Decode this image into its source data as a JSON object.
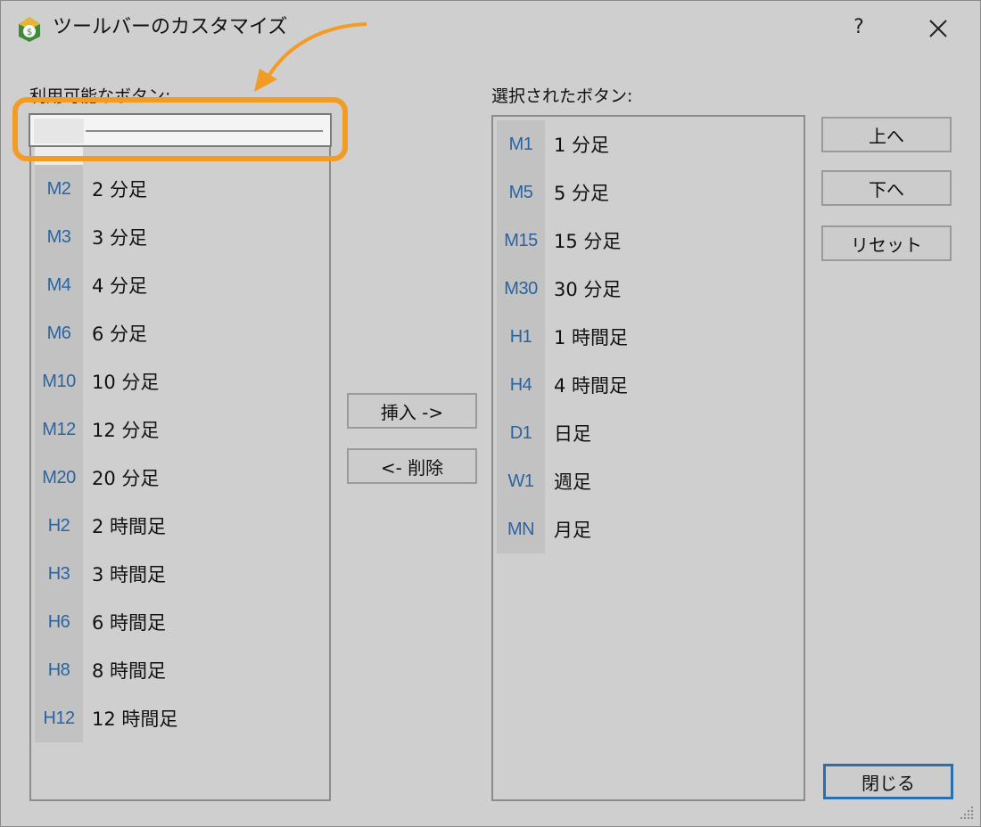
{
  "window": {
    "title": "ツールバーのカスタマイズ",
    "help_label": "?",
    "close_icon": "close-icon",
    "app_icon": "app-logo-icon"
  },
  "available": {
    "label": "利用可能なボタン:",
    "items": [
      {
        "code": "",
        "name": ""
      },
      {
        "code": "M2",
        "name": "2 分足"
      },
      {
        "code": "M3",
        "name": "3 分足"
      },
      {
        "code": "M4",
        "name": "4 分足"
      },
      {
        "code": "M6",
        "name": "6 分足"
      },
      {
        "code": "M10",
        "name": "10 分足"
      },
      {
        "code": "M12",
        "name": "12 分足"
      },
      {
        "code": "M20",
        "name": "20 分足"
      },
      {
        "code": "H2",
        "name": "2 時間足"
      },
      {
        "code": "H3",
        "name": "3 時間足"
      },
      {
        "code": "H6",
        "name": "6 時間足"
      },
      {
        "code": "H8",
        "name": "8 時間足"
      },
      {
        "code": "H12",
        "name": "12 時間足"
      }
    ]
  },
  "selected": {
    "label": "選択されたボタン:",
    "items": [
      {
        "code": "M1",
        "name": "1 分足"
      },
      {
        "code": "M5",
        "name": "5 分足"
      },
      {
        "code": "M15",
        "name": "15 分足"
      },
      {
        "code": "M30",
        "name": "30 分足"
      },
      {
        "code": "H1",
        "name": "1 時間足"
      },
      {
        "code": "H4",
        "name": "4 時間足"
      },
      {
        "code": "D1",
        "name": "日足"
      },
      {
        "code": "W1",
        "name": "週足"
      },
      {
        "code": "MN",
        "name": "月足"
      }
    ]
  },
  "buttons": {
    "insert": "挿入 ->",
    "delete": "<- 削除",
    "up": "上へ",
    "down": "下へ",
    "reset": "リセット",
    "close": "閉じる"
  },
  "colors": {
    "accent_highlight": "#f39c25",
    "code_text": "#2a64a0",
    "default_button_border": "#2b6fb0"
  }
}
